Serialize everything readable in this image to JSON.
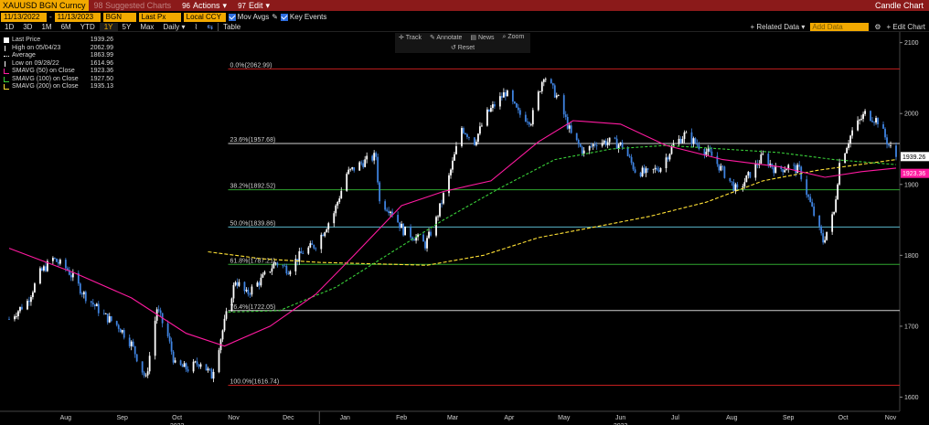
{
  "titlebar": {
    "ticker": "XAUUSD BGN Curncy",
    "suggested_num": "98",
    "suggested": "Suggested Charts",
    "actions_num": "96",
    "actions": "Actions",
    "edit_num": "97",
    "edit": "Edit",
    "chart_name": "Candle Chart"
  },
  "controls": {
    "start_date": "11/13/2022",
    "end_date": "11/13/2023",
    "source": "BGN",
    "field": "Last Px",
    "currency": "Local CCY",
    "mov_avgs": "Mov Avgs",
    "key_events": "Key Events"
  },
  "periods": {
    "items": [
      "1D",
      "3D",
      "1M",
      "6M",
      "YTD",
      "1Y",
      "5Y",
      "Max"
    ],
    "active": "1Y",
    "frequency": "Daily",
    "table": "Table"
  },
  "right_tools": {
    "related": "Related Data",
    "add_data_placeholder": "Add Data",
    "edit_chart": "Edit Chart"
  },
  "toolbar": {
    "track": "Track",
    "annotate": "Annotate",
    "news": "News",
    "zoom": "Zoom",
    "reset": "Reset"
  },
  "legend": [
    {
      "label": "Last Price",
      "value": "1939.26",
      "color": "#ffffff"
    },
    {
      "label": "High on 05/04/23",
      "value": "2062.99",
      "color": "#ffffff"
    },
    {
      "label": "Average",
      "value": "1863.99",
      "color": "#ffffff"
    },
    {
      "label": "Low on 09/28/22",
      "value": "1614.96",
      "color": "#ffffff"
    },
    {
      "label": "SMAVG (50)  on Close",
      "value": "1923.36",
      "color": "#ff1aa0"
    },
    {
      "label": "SMAVG (100)  on Close",
      "value": "1927.50",
      "color": "#39d039"
    },
    {
      "label": "SMAVG (200)  on Close",
      "value": "1935.13",
      "color": "#ffe135"
    }
  ],
  "fib_levels": [
    {
      "label": "0.0%(2062.99)",
      "value": 2062.99,
      "color": "#c41e1e",
      "text_color": "#ff4040"
    },
    {
      "label": "23.6%(1957.68)",
      "value": 1957.68,
      "color": "#cfcfcf",
      "text_color": "#d0d0d0"
    },
    {
      "label": "38.2%(1892.52)",
      "value": 1892.52,
      "color": "#2fa52f",
      "text_color": "#d0d0d0"
    },
    {
      "label": "50.0%(1839.86)",
      "value": 1839.86,
      "color": "#5ab6c9",
      "text_color": "#d0d0d0"
    },
    {
      "label": "61.8%(1787.21)",
      "value": 1787.21,
      "color": "#2fa52f",
      "text_color": "#d0d0d0"
    },
    {
      "label": "76.4%(1722.05)",
      "value": 1722.05,
      "color": "#cfcfcf",
      "text_color": "#d0d0d0"
    },
    {
      "label": "100.0%(1616.74)",
      "value": 1616.74,
      "color": "#c41e1e",
      "text_color": "#ff4040"
    }
  ],
  "chart_data": {
    "type": "candlestick",
    "y_ticks": [
      1600,
      1700,
      1800,
      1900,
      2000,
      2100
    ],
    "y_range": [
      1580,
      2115
    ],
    "x_months": [
      "Aug",
      "Sep",
      "Oct",
      "Nov",
      "Dec",
      "Jan",
      "Feb",
      "Mar",
      "Apr",
      "May",
      "Jun",
      "Jul",
      "Aug",
      "Sep",
      "Oct",
      "Nov"
    ],
    "year_labels": [
      "2022",
      "2023"
    ],
    "last_price_tag": "1939.26",
    "sma50_tag": "1923.36",
    "price_path": [
      [
        "2022-07-15",
        1710
      ],
      [
        "2022-07-25",
        1735
      ],
      [
        "2022-08-01",
        1775
      ],
      [
        "2022-08-08",
        1795
      ],
      [
        "2022-08-16",
        1780
      ],
      [
        "2022-08-25",
        1745
      ],
      [
        "2022-09-05",
        1715
      ],
      [
        "2022-09-13",
        1700
      ],
      [
        "2022-09-20",
        1675
      ],
      [
        "2022-09-28",
        1625
      ],
      [
        "2022-10-04",
        1725
      ],
      [
        "2022-10-10",
        1685
      ],
      [
        "2022-10-14",
        1645
      ],
      [
        "2022-10-21",
        1640
      ],
      [
        "2022-10-28",
        1650
      ],
      [
        "2022-11-03",
        1630
      ],
      [
        "2022-11-10",
        1705
      ],
      [
        "2022-11-16",
        1765
      ],
      [
        "2022-11-22",
        1745
      ],
      [
        "2022-11-30",
        1765
      ],
      [
        "2022-12-08",
        1790
      ],
      [
        "2022-12-15",
        1780
      ],
      [
        "2022-12-23",
        1805
      ],
      [
        "2022-12-30",
        1815
      ],
      [
        "2023-01-09",
        1860
      ],
      [
        "2023-01-16",
        1915
      ],
      [
        "2023-01-24",
        1930
      ],
      [
        "2023-02-01",
        1940
      ],
      [
        "2023-02-03",
        1875
      ],
      [
        "2023-02-09",
        1865
      ],
      [
        "2023-02-16",
        1835
      ],
      [
        "2023-02-23",
        1825
      ],
      [
        "2023-02-28",
        1815
      ],
      [
        "2023-03-06",
        1850
      ],
      [
        "2023-03-13",
        1910
      ],
      [
        "2023-03-20",
        1980
      ],
      [
        "2023-03-27",
        1960
      ],
      [
        "2023-04-03",
        2000
      ],
      [
        "2023-04-13",
        2030
      ],
      [
        "2023-04-20",
        2000
      ],
      [
        "2023-04-27",
        1990
      ],
      [
        "2023-05-04",
        2055
      ],
      [
        "2023-05-12",
        2020
      ],
      [
        "2023-05-19",
        1970
      ],
      [
        "2023-05-26",
        1945
      ],
      [
        "2023-06-02",
        1960
      ],
      [
        "2023-06-09",
        1960
      ],
      [
        "2023-06-16",
        1955
      ],
      [
        "2023-06-23",
        1920
      ],
      [
        "2023-06-30",
        1915
      ],
      [
        "2023-07-07",
        1925
      ],
      [
        "2023-07-14",
        1955
      ],
      [
        "2023-07-20",
        1970
      ],
      [
        "2023-07-28",
        1955
      ],
      [
        "2023-08-04",
        1940
      ],
      [
        "2023-08-11",
        1915
      ],
      [
        "2023-08-18",
        1890
      ],
      [
        "2023-08-25",
        1915
      ],
      [
        "2023-09-01",
        1940
      ],
      [
        "2023-09-08",
        1920
      ],
      [
        "2023-09-15",
        1925
      ],
      [
        "2023-09-21",
        1920
      ],
      [
        "2023-09-28",
        1865
      ],
      [
        "2023-10-04",
        1820
      ],
      [
        "2023-10-10",
        1860
      ],
      [
        "2023-10-13",
        1930
      ],
      [
        "2023-10-20",
        1975
      ],
      [
        "2023-10-27",
        2000
      ],
      [
        "2023-11-03",
        1990
      ],
      [
        "2023-11-09",
        1955
      ],
      [
        "2023-11-13",
        1939
      ]
    ],
    "sma50_path": [
      [
        "2022-07-15",
        1810
      ],
      [
        "2022-08-20",
        1775
      ],
      [
        "2022-09-20",
        1740
      ],
      [
        "2022-10-20",
        1690
      ],
      [
        "2022-11-10",
        1672
      ],
      [
        "2022-12-05",
        1700
      ],
      [
        "2022-12-30",
        1745
      ],
      [
        "2023-01-20",
        1800
      ],
      [
        "2023-02-15",
        1870
      ],
      [
        "2023-03-10",
        1890
      ],
      [
        "2023-04-05",
        1905
      ],
      [
        "2023-05-01",
        1960
      ],
      [
        "2023-05-20",
        1990
      ],
      [
        "2023-06-15",
        1985
      ],
      [
        "2023-07-10",
        1955
      ],
      [
        "2023-08-10",
        1935
      ],
      [
        "2023-09-10",
        1925
      ],
      [
        "2023-10-05",
        1910
      ],
      [
        "2023-10-25",
        1918
      ],
      [
        "2023-11-13",
        1923
      ]
    ],
    "sma100_path": [
      [
        "2022-11-12",
        1720
      ],
      [
        "2022-12-10",
        1722
      ],
      [
        "2023-01-10",
        1755
      ],
      [
        "2023-02-10",
        1805
      ],
      [
        "2023-03-10",
        1850
      ],
      [
        "2023-04-10",
        1895
      ],
      [
        "2023-05-10",
        1935
      ],
      [
        "2023-06-10",
        1950
      ],
      [
        "2023-07-10",
        1955
      ],
      [
        "2023-08-10",
        1950
      ],
      [
        "2023-09-10",
        1945
      ],
      [
        "2023-10-10",
        1935
      ],
      [
        "2023-11-13",
        1928
      ]
    ],
    "sma200_path": [
      [
        "2022-11-01",
        1805
      ],
      [
        "2022-12-01",
        1795
      ],
      [
        "2023-01-01",
        1790
      ],
      [
        "2023-02-01",
        1788
      ],
      [
        "2023-03-01",
        1786
      ],
      [
        "2023-04-01",
        1800
      ],
      [
        "2023-05-01",
        1825
      ],
      [
        "2023-06-01",
        1840
      ],
      [
        "2023-07-01",
        1855
      ],
      [
        "2023-08-01",
        1875
      ],
      [
        "2023-09-01",
        1905
      ],
      [
        "2023-10-01",
        1920
      ],
      [
        "2023-11-13",
        1935
      ]
    ]
  }
}
